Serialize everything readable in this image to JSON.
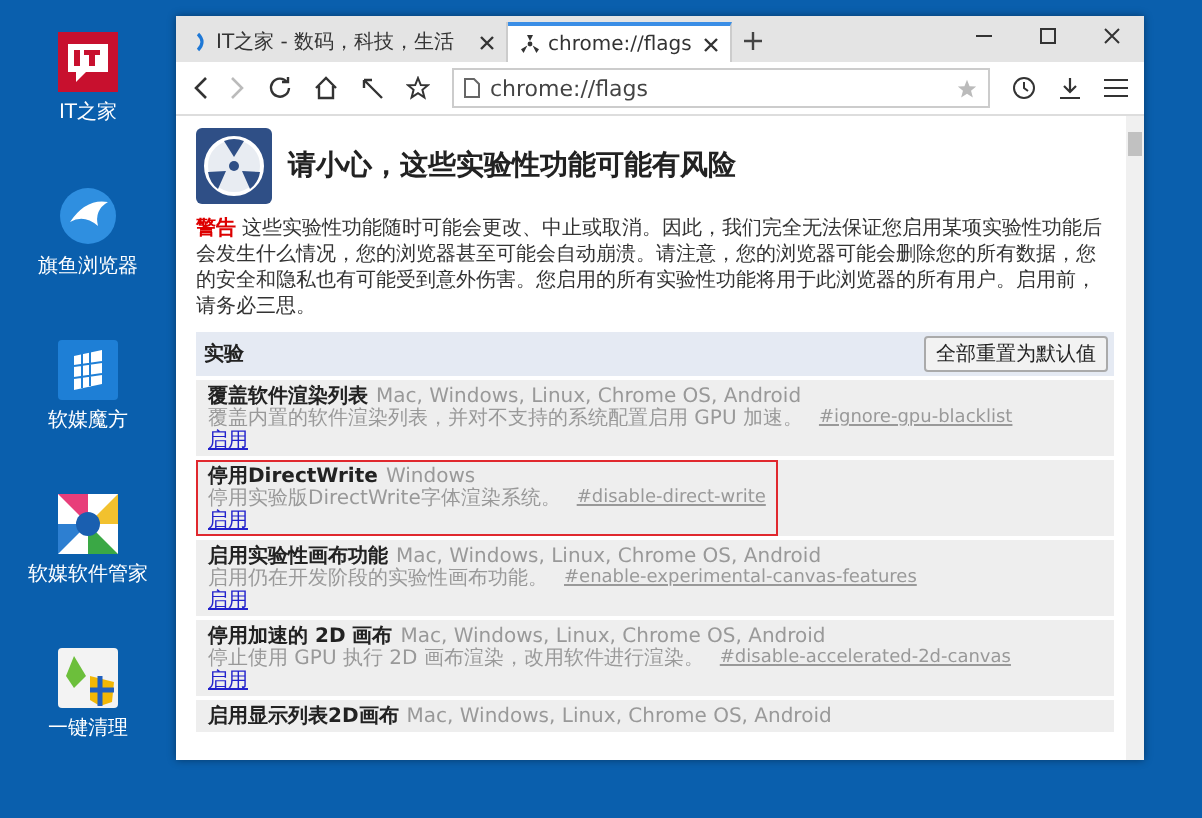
{
  "desktop_icons": [
    {
      "label": "IT之家",
      "kind": "it"
    },
    {
      "label": "旗鱼浏览器",
      "kind": "fish"
    },
    {
      "label": "软媒魔方",
      "kind": "cube"
    },
    {
      "label": "软媒软件管家",
      "kind": "pinwheel"
    },
    {
      "label": "一键清理",
      "kind": "broom"
    }
  ],
  "browser": {
    "tabs": [
      {
        "label": "IT之家 - 数码，科技，生活",
        "selected": false
      },
      {
        "label": "chrome://flags",
        "selected": true
      }
    ],
    "address": "chrome://flags",
    "page": {
      "title": "请小心，这些实验性功能可能有风险",
      "warning_label": "警告",
      "warning_text": "这些实验性功能随时可能会更改、中止或取消。因此，我们完全无法保证您启用某项实验性功能后会发生什么情况，您的浏览器甚至可能会自动崩溃。请注意，您的浏览器可能会删除您的所有数据，您的安全和隐私也有可能受到意外伤害。您启用的所有实验性功能将用于此浏览器的所有用户。启用前，请务必三思。",
      "section": "实验",
      "reset_button": "全部重置为默认值",
      "experiments": [
        {
          "name": "覆盖软件渲染列表",
          "platforms": "Mac, Windows, Linux, Chrome OS, Android",
          "description": "覆盖内置的软件渲染列表，并对不支持的系统配置启用 GPU 加速。",
          "hash": "#ignore-gpu-blacklist",
          "action": "启用",
          "highlighted": false
        },
        {
          "name": "停用DirectWrite",
          "platforms": "Windows",
          "description": "停用实验版DirectWrite字体渲染系统。",
          "hash": "#disable-direct-write",
          "action": "启用",
          "highlighted": true
        },
        {
          "name": "启用实验性画布功能",
          "platforms": "Mac, Windows, Linux, Chrome OS, Android",
          "description": "启用仍在开发阶段的实验性画布功能。",
          "hash": "#enable-experimental-canvas-features",
          "action": "启用",
          "highlighted": false
        },
        {
          "name": "停用加速的 2D 画布",
          "platforms": "Mac, Windows, Linux, Chrome OS, Android",
          "description": "停止使用 GPU 执行 2D 画布渲染，改用软件进行渲染。",
          "hash": "#disable-accelerated-2d-canvas",
          "action": "启用",
          "highlighted": false
        },
        {
          "name": "启用显示列表2D画布",
          "platforms": "Mac, Windows, Linux, Chrome OS, Android",
          "highlighted": false
        }
      ]
    }
  }
}
